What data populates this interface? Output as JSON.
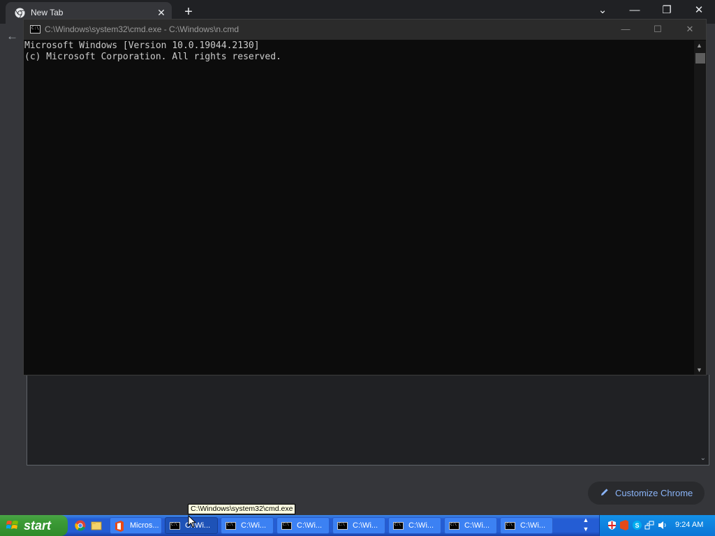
{
  "browser": {
    "tab": {
      "title": "New Tab",
      "close_glyph": "✕"
    },
    "newtab_glyph": "+",
    "window_controls": {
      "dropdown": "⌄",
      "minimize": "—",
      "restore": "❐",
      "close": "✕"
    },
    "back_glyph": "←",
    "customize_label": "Customize Chrome"
  },
  "cmd": {
    "title": "C:\\Windows\\system32\\cmd.exe - C:\\Windows\\n.cmd",
    "icon_text": "C:\\",
    "buttons": {
      "minimize": "—",
      "maximize": "☐",
      "close": "✕"
    },
    "console_lines": [
      "Microsoft Windows [Version 10.0.19044.2130]",
      "(c) Microsoft Corporation. All rights reserved."
    ]
  },
  "tooltip": "C:\\Windows\\system32\\cmd.exe",
  "taskbar": {
    "start_label": "start",
    "tasks": [
      {
        "label": "Micros...",
        "icon": "office-icon"
      },
      {
        "label": "C:\\Wi...",
        "icon": "cmd-icon"
      },
      {
        "label": "C:\\Wi...",
        "icon": "cmd-icon"
      },
      {
        "label": "C:\\Wi...",
        "icon": "cmd-icon"
      },
      {
        "label": "C:\\Wi...",
        "icon": "cmd-icon"
      },
      {
        "label": "C:\\Wi...",
        "icon": "cmd-icon"
      },
      {
        "label": "C:\\Wi...",
        "icon": "cmd-icon"
      },
      {
        "label": "C:\\Wi...",
        "icon": "cmd-icon"
      }
    ],
    "clock": "9:24 AM"
  },
  "colors": {
    "console_bg": "#0c0c0c",
    "console_text": "#cccccc",
    "chrome_accent": "#8ab4f8",
    "xp_taskbar": "#245dd4",
    "xp_start": "#3c9b36"
  }
}
